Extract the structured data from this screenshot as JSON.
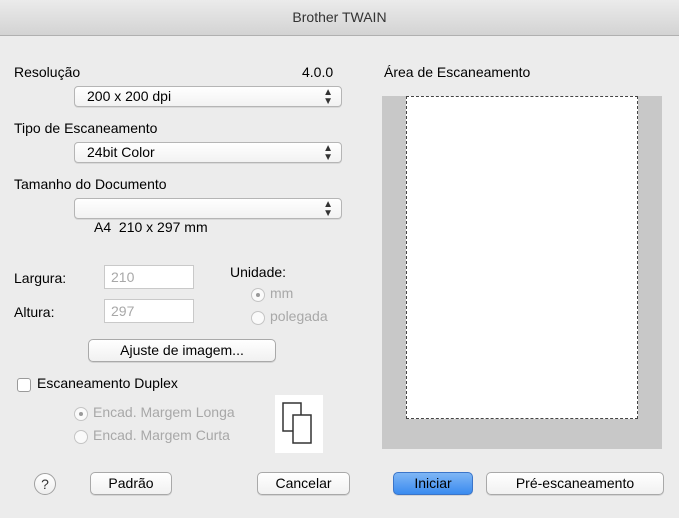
{
  "window": {
    "title": "Brother TWAIN"
  },
  "settings": {
    "resolution_label": "Resolução",
    "version": "4.0.0",
    "resolution_value": "200 x 200 dpi",
    "scan_type_label": "Tipo de Escaneamento",
    "scan_type_value": "24bit Color",
    "doc_size_label": "Tamanho do Documento",
    "doc_size_value": "A4  210 x 297 mm"
  },
  "dimensions": {
    "width_label": "Largura:",
    "width_value": "210",
    "height_label": "Altura:",
    "height_value": "297",
    "unit_label": "Unidade:",
    "unit_options": [
      "mm",
      "polegada"
    ],
    "unit_selected": "mm"
  },
  "buttons": {
    "adjust_image": "Ajuste de imagem...",
    "default": "Padrão",
    "cancel": "Cancelar",
    "start": "Iniciar",
    "prescan": "Pré-escaneamento",
    "help": "?"
  },
  "duplex": {
    "label": "Escaneamento Duplex",
    "checked": false,
    "options": [
      "Encad. Margem Longa",
      "Encad. Margem Curta"
    ],
    "selected": "Encad. Margem Longa"
  },
  "scan_area": {
    "label": "Área de Escaneamento"
  },
  "icons": {
    "popup_arrows": "up-down-arrows-icon",
    "duplex_pages": "duplex-pages-icon",
    "help": "question-mark-icon"
  },
  "colors": {
    "window_bg": "#ececec",
    "default_button": "#3a8bef",
    "scan_area_border": "#c8c8c8"
  }
}
